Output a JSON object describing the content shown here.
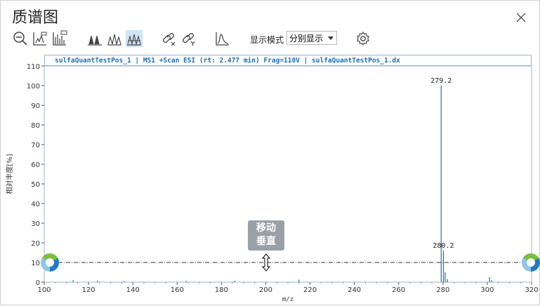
{
  "window": {
    "title": "质谱图",
    "close_icon": "close-icon"
  },
  "toolbar": {
    "buttons": [
      {
        "name": "zoom-out-icon"
      },
      {
        "name": "spectrum-peak-icon"
      },
      {
        "name": "spectrum-table-icon"
      },
      {
        "name": "stack-icon-1"
      },
      {
        "name": "stack-icon-2"
      },
      {
        "name": "stack-icon-3"
      },
      {
        "name": "link-x-icon"
      },
      {
        "name": "link-y-icon"
      },
      {
        "name": "peak-shape-icon"
      }
    ],
    "mode_label": "显示模式",
    "mode_value": "分别显示",
    "settings_icon": "gear-icon"
  },
  "plot": {
    "header": "sulfaQuantTestPos_1 | MS1 +Scan ESI (rt: 2.477 min) Frag=110V | sulfaQuantTestPos_1.dx",
    "hint_line1": "移动",
    "hint_line2": "垂直",
    "threshold_line_value": 10
  },
  "chart_data": {
    "type": "bar",
    "xlabel": "m/z",
    "ylabel": "相对丰度[%]",
    "xlim": [
      100,
      320
    ],
    "ylim": [
      0,
      110
    ],
    "xticks": [
      100,
      120,
      140,
      160,
      180,
      200,
      220,
      240,
      260,
      280,
      300,
      320
    ],
    "yticks": [
      0,
      10,
      20,
      30,
      40,
      50,
      60,
      70,
      80,
      90,
      100,
      110
    ],
    "peaks": [
      {
        "x": 113.0,
        "y": 1.0
      },
      {
        "x": 124.0,
        "y": 0.6
      },
      {
        "x": 136.0,
        "y": 0.5
      },
      {
        "x": 164.0,
        "y": 0.6
      },
      {
        "x": 186.0,
        "y": 0.7
      },
      {
        "x": 215.0,
        "y": 1.2
      },
      {
        "x": 279.2,
        "y": 100,
        "label": "279.2"
      },
      {
        "x": 280.2,
        "y": 16,
        "label": "280.2"
      },
      {
        "x": 281.0,
        "y": 5.0
      },
      {
        "x": 282.0,
        "y": 1.5
      },
      {
        "x": 301.0,
        "y": 2.5
      },
      {
        "x": 302.0,
        "y": 1.0
      }
    ]
  }
}
